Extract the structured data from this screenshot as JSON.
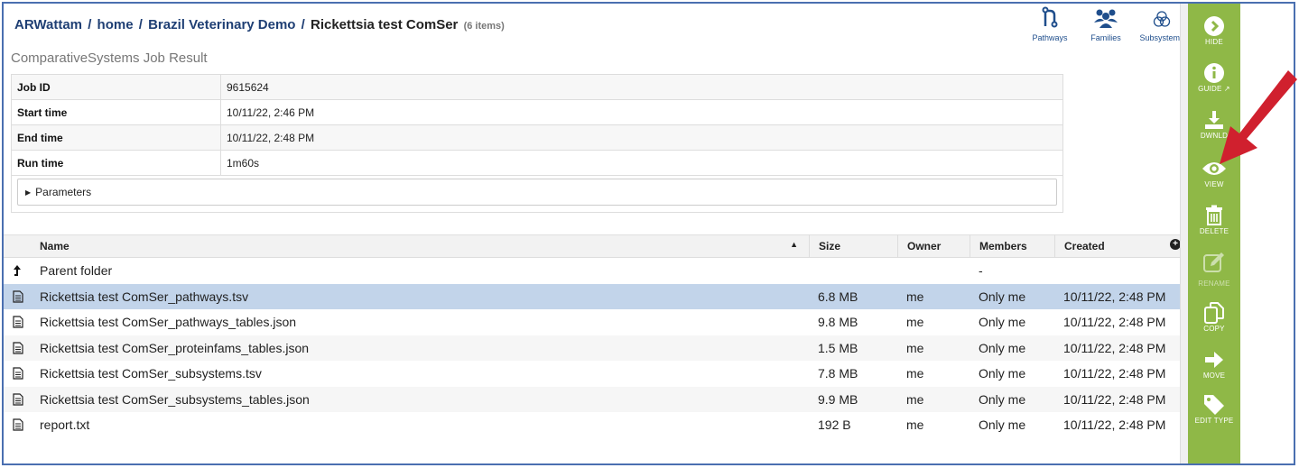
{
  "breadcrumb": {
    "items": [
      "ARWattam",
      "home",
      "Brazil Veterinary Demo"
    ],
    "current": "Rickettsia test ComSer",
    "count": "(6 items)"
  },
  "top_icons": [
    {
      "label": "Pathways",
      "icon": "pathways-icon"
    },
    {
      "label": "Families",
      "icon": "families-icon"
    },
    {
      "label": "Subsystems",
      "icon": "subsystems-icon"
    }
  ],
  "job": {
    "title": "ComparativeSystems Job Result",
    "rows": [
      {
        "key": "Job ID",
        "value": "9615624"
      },
      {
        "key": "Start time",
        "value": "10/11/22, 2:46 PM"
      },
      {
        "key": "End time",
        "value": "10/11/22, 2:48 PM"
      },
      {
        "key": "Run time",
        "value": "1m60s"
      }
    ],
    "parameters_label": "Parameters"
  },
  "grid": {
    "headers": {
      "name": "Name",
      "size": "Size",
      "owner": "Owner",
      "members": "Members",
      "created": "Created"
    },
    "parent": {
      "name": "Parent folder",
      "members": "-"
    },
    "rows": [
      {
        "name": "Rickettsia test ComSer_pathways.tsv",
        "size": "6.8 MB",
        "owner": "me",
        "members": "Only me",
        "created": "10/11/22, 2:48 PM"
      },
      {
        "name": "Rickettsia test ComSer_pathways_tables.json",
        "size": "9.8 MB",
        "owner": "me",
        "members": "Only me",
        "created": "10/11/22, 2:48 PM"
      },
      {
        "name": "Rickettsia test ComSer_proteinfams_tables.json",
        "size": "1.5 MB",
        "owner": "me",
        "members": "Only me",
        "created": "10/11/22, 2:48 PM"
      },
      {
        "name": "Rickettsia test ComSer_subsystems.tsv",
        "size": "7.8 MB",
        "owner": "me",
        "members": "Only me",
        "created": "10/11/22, 2:48 PM"
      },
      {
        "name": "Rickettsia test ComSer_subsystems_tables.json",
        "size": "9.9 MB",
        "owner": "me",
        "members": "Only me",
        "created": "10/11/22, 2:48 PM"
      },
      {
        "name": "report.txt",
        "size": "192 B",
        "owner": "me",
        "members": "Only me",
        "created": "10/11/22, 2:48 PM"
      }
    ]
  },
  "toolbar": {
    "hide": "HIDE",
    "guide": "GUIDE",
    "download": "DWNLD",
    "view": "VIEW",
    "delete": "DELETE",
    "rename": "RENAME",
    "copy": "COPY",
    "move": "MOVE",
    "edit_type": "EDIT TYPE"
  },
  "colors": {
    "toolbar_green": "#8fb847",
    "breadcrumb_blue": "#1f3f74",
    "selected_row": "#c2d4ea",
    "annotation_arrow": "#d0202e"
  }
}
